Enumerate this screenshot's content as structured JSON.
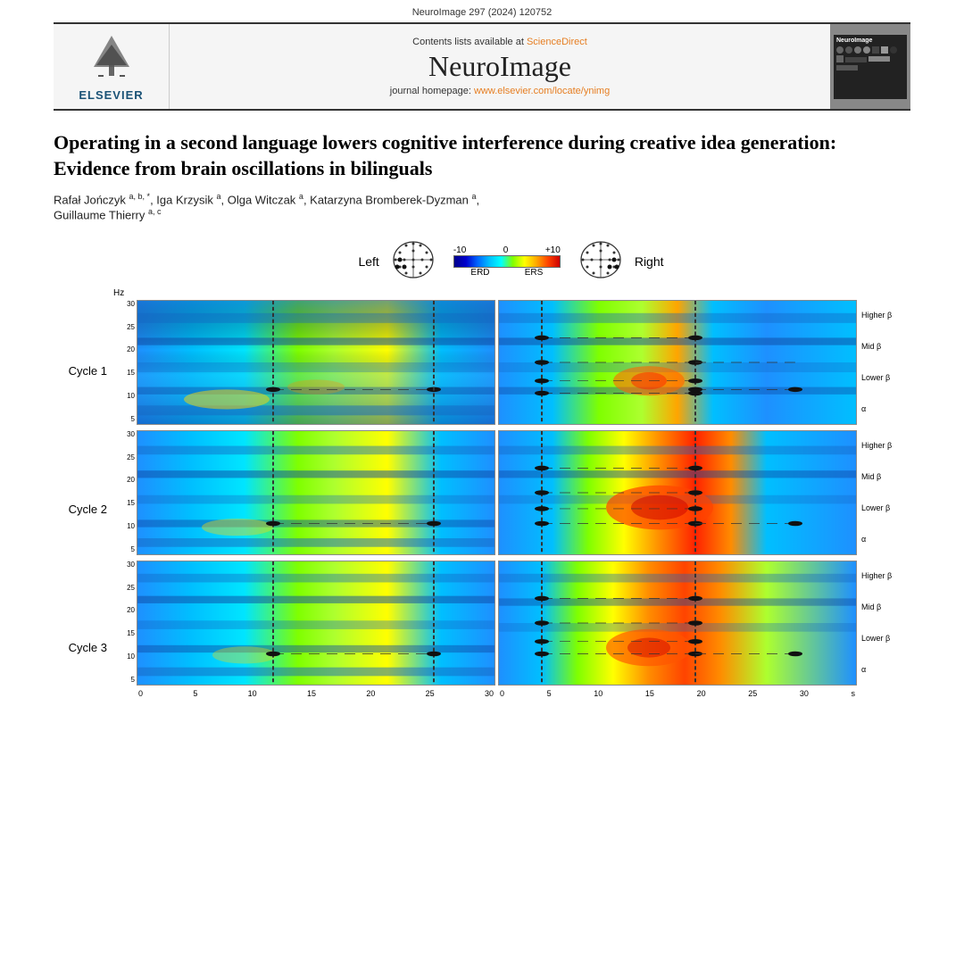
{
  "journal_ref": "NeuroImage 297 (2024) 120752",
  "header": {
    "contents_line": "Contents lists available at",
    "sciencedirect": "ScienceDirect",
    "journal_name": "NeuroImage",
    "homepage_label": "journal homepage:",
    "homepage_url": "www.elsevier.com/locate/ynimg",
    "elsevier": "ELSEVIER"
  },
  "article": {
    "title": "Operating in a second language lowers cognitive interference during creative idea generation: Evidence from brain oscillations in bilinguals",
    "authors": "Rafał Jończyk a, b, *, Iga Krzysik a, Olga Witczak a, Katarzyna Bromberek-Dyzman a, Guillaume Thierry a, c"
  },
  "figure": {
    "left_label": "Left",
    "right_label": "Right",
    "colorbar": {
      "min": "-10",
      "zero": "0",
      "max": "+10",
      "erd_label": "ERD",
      "ers_label": "ERS"
    },
    "cycles": [
      "Cycle 1",
      "Cycle 2",
      "Cycle 3"
    ],
    "y_axis_title": "Hz",
    "y_ticks": [
      "30",
      "25",
      "20",
      "15",
      "10",
      "5"
    ],
    "x_ticks": [
      "0",
      "5",
      "10",
      "15",
      "20",
      "25",
      "30"
    ],
    "x_unit": "s",
    "freq_bands": {
      "higher_beta": "Higher β",
      "mid_beta": "Mid β",
      "lower_beta": "Lower β",
      "alpha": "α"
    }
  }
}
